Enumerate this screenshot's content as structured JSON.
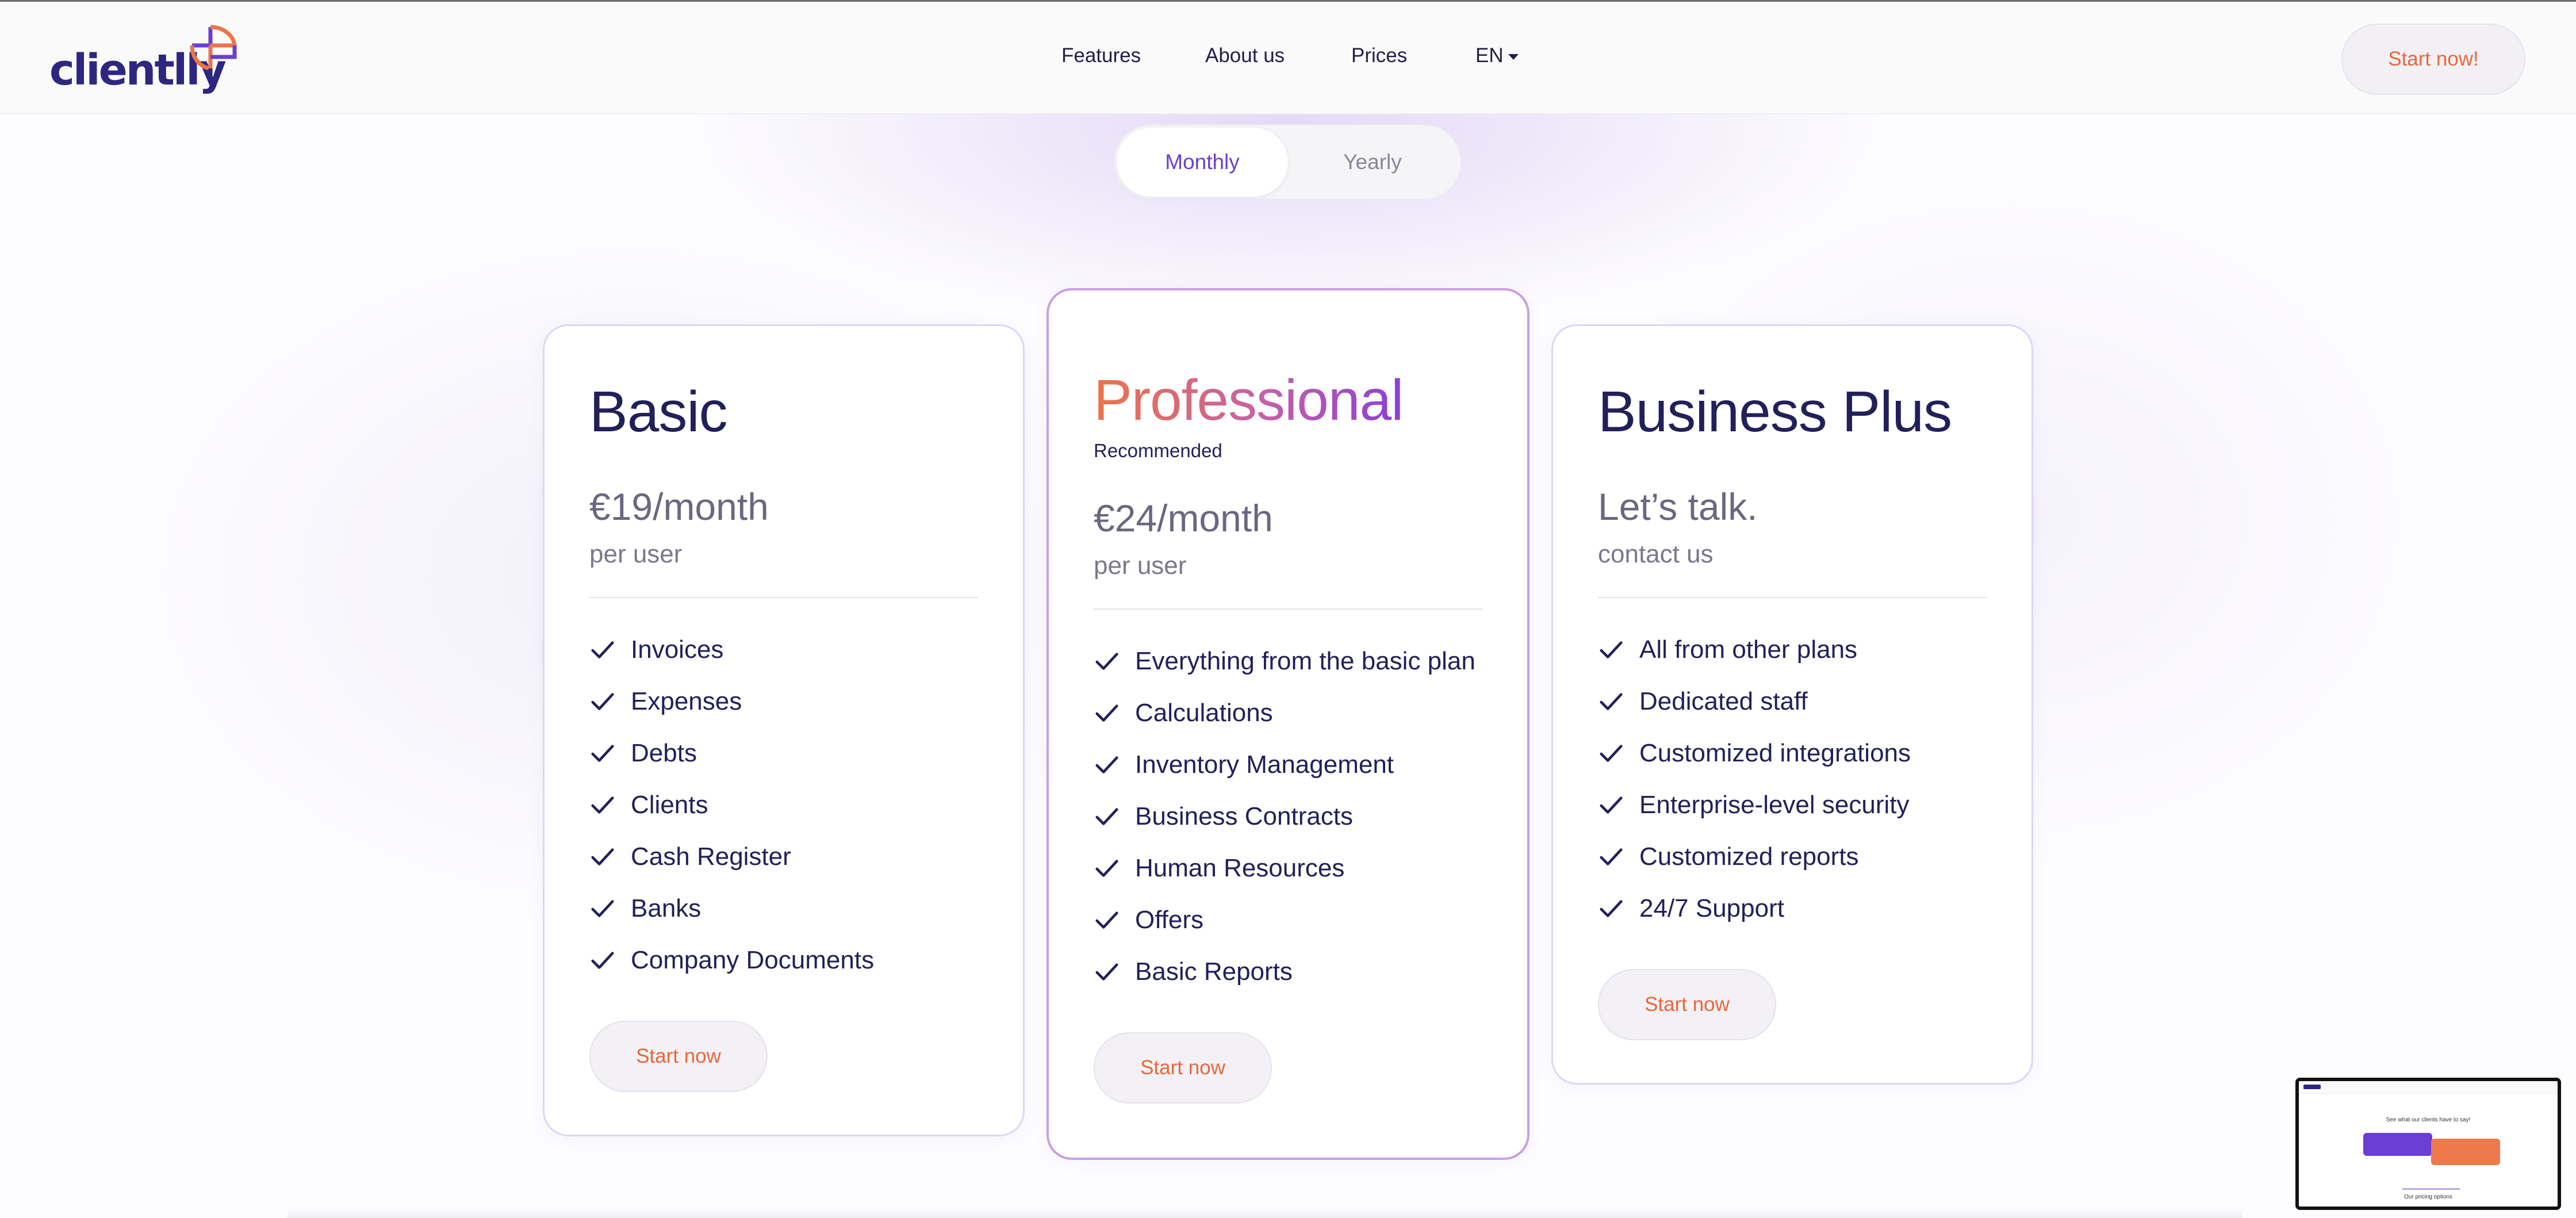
{
  "header": {
    "logo_text": "clientlly",
    "nav": [
      {
        "label": "Features"
      },
      {
        "label": "About us"
      },
      {
        "label": "Prices"
      },
      {
        "label": "EN"
      }
    ],
    "cta_label": "Start now!"
  },
  "billing_toggle": {
    "options": [
      "Monthly",
      "Yearly"
    ],
    "selected": "Monthly"
  },
  "plans": [
    {
      "name": "Basic",
      "price": "€19/month",
      "price_sub": "per user",
      "features": [
        "Invoices",
        "Expenses",
        "Debts",
        "Clients",
        "Cash Register",
        "Banks",
        "Company Documents"
      ],
      "cta_label": "Start now"
    },
    {
      "name": "Professional",
      "badge": "Recommended",
      "price": "€24/month",
      "price_sub": "per user",
      "features": [
        "Everything from the basic plan",
        "Calculations",
        "Inventory Management",
        "Business Contracts",
        "Human Resources",
        "Offers",
        "Basic Reports"
      ],
      "cta_label": "Start now"
    },
    {
      "name": "Business Plus",
      "price": "Let’s talk.",
      "price_sub": "contact us",
      "features": [
        "All from other plans",
        "Dedicated staff",
        "Customized integrations",
        "Enterprise-level security",
        "Customized reports",
        "24/7 Support"
      ],
      "cta_label": "Start now"
    }
  ],
  "thumbnail": {
    "title": "See what our clients have to say!",
    "footer": "Our pricing options"
  },
  "colors": {
    "accent_orange": "#e8673a",
    "accent_purple": "#6a3fd1",
    "text_dark": "#22205a",
    "logo_blue": "#2d2780"
  },
  "icons": {
    "check": "check-icon",
    "caret": "chevron-down-icon",
    "logo": "clientlly-logo-mark"
  }
}
